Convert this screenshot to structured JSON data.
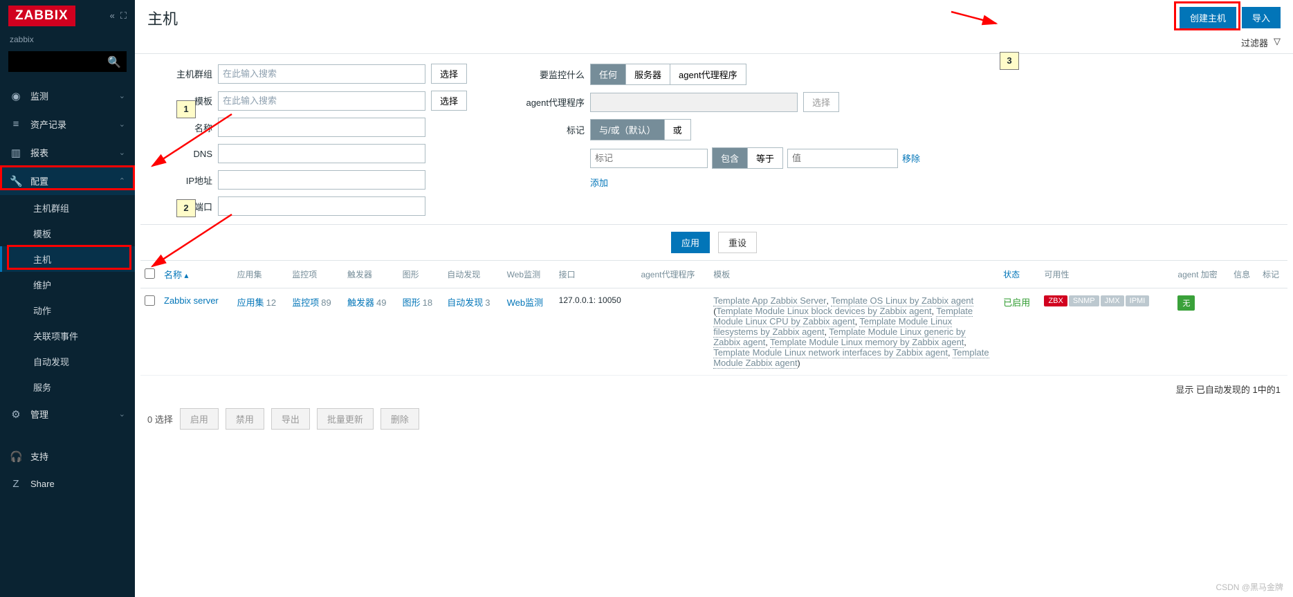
{
  "brand": "ZABBIX",
  "site": "zabbix",
  "page_title": "主机",
  "head": {
    "create": "创建主机",
    "import": "导入"
  },
  "filter_label": "过滤器",
  "nav": [
    {
      "icon": "◉",
      "label": "监测",
      "exp": false
    },
    {
      "icon": "≡",
      "label": "资产记录",
      "exp": false
    },
    {
      "icon": "▥",
      "label": "报表",
      "exp": false
    },
    {
      "icon": "🔧",
      "label": "配置",
      "exp": true,
      "subs": [
        "主机群组",
        "模板",
        "主机",
        "维护",
        "动作",
        "关联项事件",
        "自动发现",
        "服务"
      ]
    },
    {
      "icon": "⚙",
      "label": "管理",
      "exp": false
    },
    {
      "icon": "🎧",
      "label": "支持"
    },
    {
      "icon": "Z",
      "label": "Share"
    }
  ],
  "filters": {
    "labels": {
      "hostgroup": "主机群组",
      "template": "模板",
      "name": "名称",
      "dns": "DNS",
      "ip": "IP地址",
      "port": "端口",
      "monitored": "要监控什么",
      "proxy": "agent代理程序",
      "tags": "标记"
    },
    "ph_search": "在此输入搜索",
    "select": "选择",
    "monitored_opts": [
      "任何",
      "服务器",
      "agent代理程序"
    ],
    "tag_logic": [
      "与/或（默认）",
      "或"
    ],
    "tag_op": [
      "包含",
      "等于"
    ],
    "tag_key_ph": "标记",
    "tag_val_ph": "值",
    "remove": "移除",
    "add": "添加",
    "apply": "应用",
    "reset": "重设"
  },
  "cols": {
    "name": "名称",
    "app": "应用集",
    "items": "监控项",
    "triggers": "触发器",
    "graphs": "图形",
    "discovery": "自动发现",
    "web": "Web监测",
    "iface": "接口",
    "proxy": "agent代理程序",
    "templates": "模板",
    "status": "状态",
    "avail": "可用性",
    "agent_enc": "agent 加密",
    "info": "信息",
    "tags": "标记"
  },
  "row": {
    "name": "Zabbix server",
    "app": {
      "t": "应用集",
      "n": "12"
    },
    "items": {
      "t": "监控项",
      "n": "89"
    },
    "triggers": {
      "t": "触发器",
      "n": "49"
    },
    "graphs": {
      "t": "图形",
      "n": "18"
    },
    "discovery": {
      "t": "自动发现",
      "n": "3"
    },
    "web": "Web监测",
    "iface": "127.0.0.1: 10050",
    "templates_main": [
      "Template App Zabbix Server",
      "Template OS Linux by Zabbix agent"
    ],
    "templates_sub": [
      "Template Module Linux block devices by Zabbix agent",
      "Template Module Linux CPU by Zabbix agent",
      "Template Module Linux filesystems by Zabbix agent",
      "Template Module Linux generic by Zabbix agent",
      "Template Module Linux memory by Zabbix agent",
      "Template Module Linux network interfaces by Zabbix agent",
      "Template Module Zabbix agent"
    ],
    "status": "已启用",
    "avail": [
      "ZBX",
      "SNMP",
      "JMX",
      "IPMI"
    ],
    "enc": "无"
  },
  "foot": "显示 已自动发现的 1中的1",
  "bulk": {
    "count": "0 选择",
    "enable": "启用",
    "disable": "禁用",
    "export": "导出",
    "mass": "批量更新",
    "delete": "删除"
  },
  "annot": {
    "a1": "1",
    "a2": "2",
    "a3": "3"
  },
  "watermark": "CSDN @黑马金牌"
}
